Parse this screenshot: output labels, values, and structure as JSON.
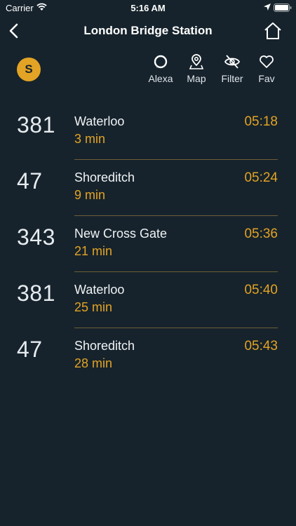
{
  "status_bar": {
    "carrier": "Carrier",
    "time": "5:16 AM"
  },
  "nav": {
    "title": "London Bridge Station",
    "back_icon": "chevron-left-icon",
    "home_icon": "home-icon"
  },
  "service": {
    "badge": "S"
  },
  "toolbar": {
    "alexa_label": "Alexa",
    "map_label": "Map",
    "filter_label": "Filter",
    "fav_label": "Fav"
  },
  "departures": [
    {
      "route": "381",
      "destination": "Waterloo",
      "wait": "3 min",
      "time": "05:18"
    },
    {
      "route": "47",
      "destination": "Shoreditch",
      "wait": "9 min",
      "time": "05:24"
    },
    {
      "route": "343",
      "destination": "New Cross Gate",
      "wait": "21 min",
      "time": "05:36"
    },
    {
      "route": "381",
      "destination": "Waterloo",
      "wait": "25 min",
      "time": "05:40"
    },
    {
      "route": "47",
      "destination": "Shoreditch",
      "wait": "28 min",
      "time": "05:43"
    }
  ],
  "colors": {
    "background": "#16232c",
    "accent": "#e3a324",
    "divider": "#6e5d36",
    "text": "#ffffff"
  }
}
